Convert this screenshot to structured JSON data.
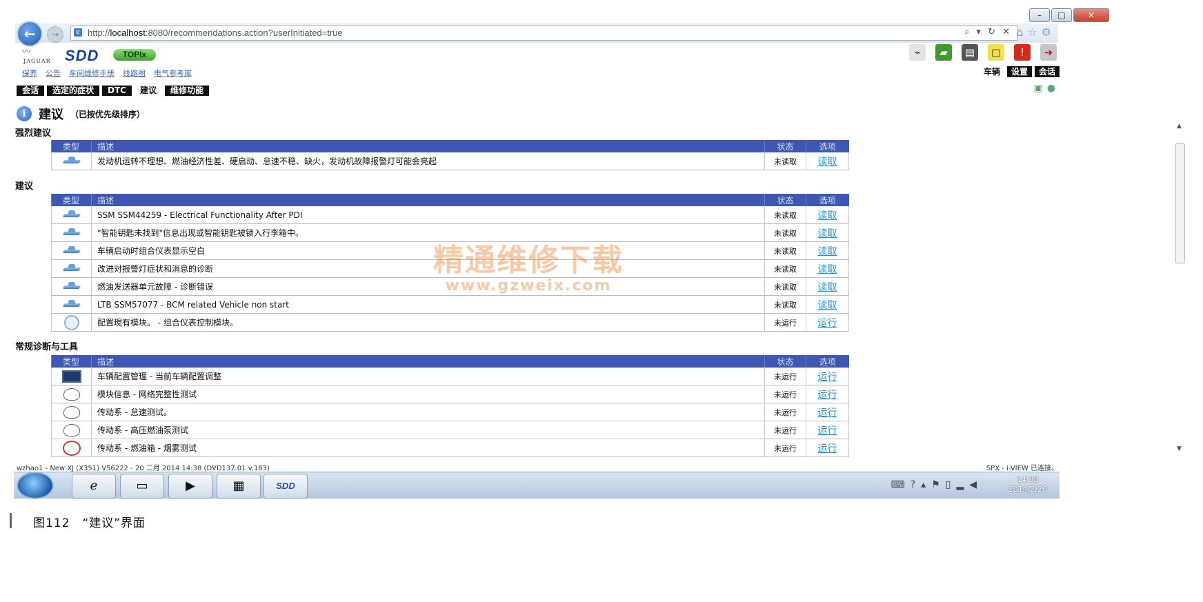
{
  "browser": {
    "url_prefix": "http://",
    "url_host": "localhost",
    "url_rest": ":8080/recommendations.action?userInitiated=true",
    "address_tools": "⌕ ▾ ↻ ✕",
    "window_buttons": [
      "–",
      "□",
      "✕"
    ]
  },
  "header": {
    "brand": "JAGUAR",
    "app_name": "SDD",
    "topix_label": "TOPIx",
    "sublinks": [
      "保养",
      "公告",
      "车间维修手册",
      "线路图",
      "电气参考库"
    ],
    "topright_tabs": [
      "车辆",
      "设置",
      "会话"
    ],
    "main_tabs": [
      "会话",
      "选定的症状",
      "DTC",
      "建议",
      "维修功能"
    ],
    "active_main_tab": "建议"
  },
  "page": {
    "title": "建议",
    "subtitle": "（已按优先级排序）",
    "columns": {
      "type": "类型",
      "desc": "描述",
      "state": "状态",
      "option": "选项"
    },
    "sections": [
      {
        "label": "强烈建议",
        "rows": [
          {
            "icon": "wrench-icon",
            "desc": "发动机运转不理想、燃油经济性差、硬启动、怠速不稳、缺火，发动机故障报警灯可能会亮起",
            "state": "未读取",
            "option": "读取"
          }
        ]
      },
      {
        "label": "建议",
        "rows": [
          {
            "icon": "wrench-icon",
            "desc": "SSM SSM44259 - Electrical Functionality After PDI",
            "state": "未读取",
            "option": "读取"
          },
          {
            "icon": "wrench-icon",
            "desc": "\"智能钥匙未找到\"信息出现或智能钥匙被锁入行李箱中。",
            "state": "未读取",
            "option": "读取"
          },
          {
            "icon": "wrench-icon",
            "desc": "车辆启动时组合仪表显示空白",
            "state": "未读取",
            "option": "读取"
          },
          {
            "icon": "wrench-icon",
            "desc": "改进对报警灯症状和消息的诊断",
            "state": "未读取",
            "option": "读取"
          },
          {
            "icon": "wrench-icon",
            "desc": "燃油发送器单元故障 - 诊断错误",
            "state": "未读取",
            "option": "读取"
          },
          {
            "icon": "wrench-icon",
            "desc": "LTB SSM57077 - BCM related Vehicle non start",
            "state": "未读取",
            "option": "读取"
          },
          {
            "icon": "module-icon",
            "desc": "配置現有模块。 - 组合仪表控制模块。",
            "state": "未运行",
            "option": "运行"
          }
        ]
      },
      {
        "label": "常规诊断与工具",
        "rows": [
          {
            "icon": "screen-icon",
            "desc": "车辆配置管理 - 当前车辆配置调整",
            "state": "未运行",
            "option": "运行"
          },
          {
            "icon": "gauge-icon",
            "desc": "模块信息 - 网络完整性测试",
            "state": "未运行",
            "option": "运行"
          },
          {
            "icon": "gauge-icon",
            "desc": "传动系 - 怠速测试。",
            "state": "未运行",
            "option": "运行"
          },
          {
            "icon": "gauge-icon",
            "desc": "传动系 - 高压燃油泵测试",
            "state": "未运行",
            "option": "运行"
          },
          {
            "icon": "gauge-red-icon",
            "desc": "传动系 - 燃油箱 - 烟雾测试",
            "state": "未运行",
            "option": "运行"
          }
        ]
      }
    ]
  },
  "watermark": {
    "cn": "精通维修下载",
    "url": "www.gzweix.com"
  },
  "statusbar": {
    "left": "wzhao1 - New XJ (X351) V56222 - 20 二月 2014 14:38 (DVD137.01 v.163)",
    "right": "SPX - i-VIEW 已连接。"
  },
  "taskbar": {
    "sdd_label": "SDD",
    "time": "14:38",
    "date": "2014/2/20"
  },
  "caption": "图112　“建议”界面",
  "colors": {
    "table_header": "#3e57b2",
    "link": "#2f8fd6",
    "watermark": "#ef8c3d"
  }
}
